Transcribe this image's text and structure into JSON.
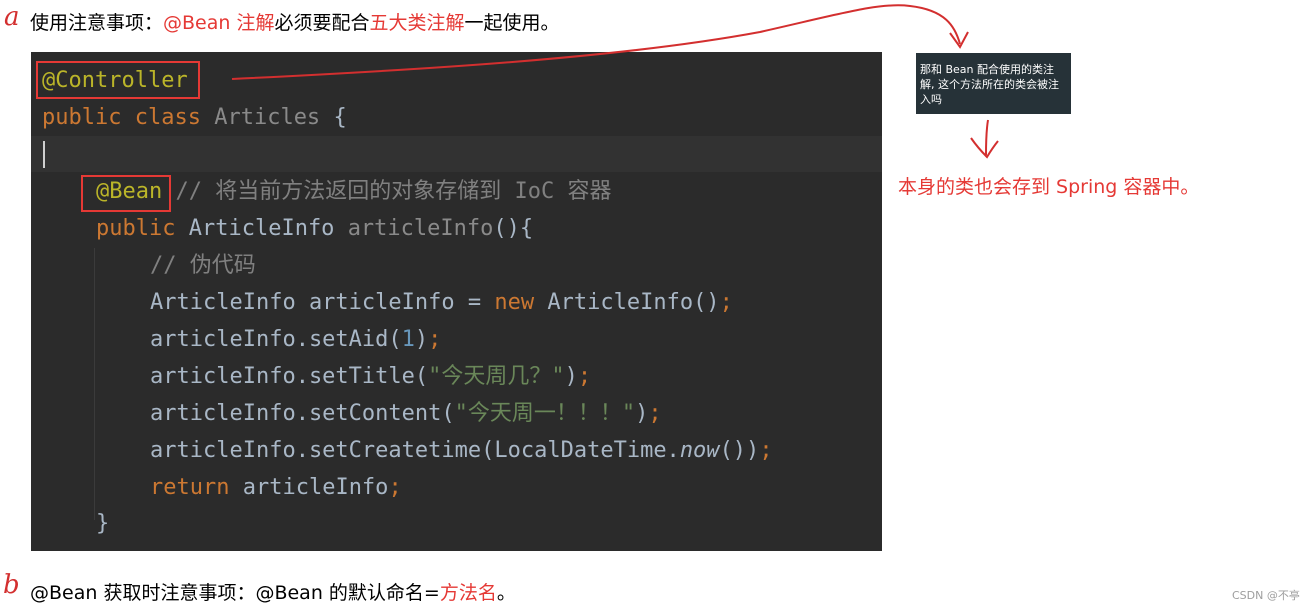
{
  "notes": {
    "a_marker": "a",
    "a_part1": "使用注意事项：",
    "a_part2": "@Bean 注解",
    "a_part3": "必须要配合",
    "a_part4": "五大类注解",
    "a_part5": "一起使用。",
    "b_marker": "b",
    "b_part1": "@Bean 获取时注意事项：@Bean 的默认命名=",
    "b_part2": "方法名",
    "b_part3": "。"
  },
  "code": {
    "l1_annotation": "@Controller",
    "l2_kw1": "public",
    "l2_kw2": "class",
    "l2_name": "Articles",
    "l2_brace": "{",
    "l4_annotation": "@Bean",
    "l4_comment": "// 将当前方法返回的对象存储到 IoC 容器",
    "l5_kw": "public",
    "l5_type": "ArticleInfo",
    "l5_method": "articleInfo",
    "l5_rest": "(){",
    "l6_comment": "// 伪代码",
    "l7_a": "ArticleInfo articleInfo = ",
    "l7_kw": "new",
    "l7_b": " ArticleInfo()",
    "l7_semi": ";",
    "l8_a": "articleInfo.setAid(",
    "l8_num": "1",
    "l8_b": ")",
    "l8_semi": ";",
    "l9_a": "articleInfo.setTitle(",
    "l9_str": "\"今天周几？\"",
    "l9_b": ")",
    "l9_semi": ";",
    "l10_a": "articleInfo.setContent(",
    "l10_str": "\"今天周一！！！\"",
    "l10_b": ")",
    "l10_semi": ";",
    "l11_a": "articleInfo.setCreatetime(LocalDateTime.",
    "l11_it": "now",
    "l11_b": "())",
    "l11_semi": ";",
    "l12_kw": "return",
    "l12_rest": " articleInfo",
    "l12_semi": ";",
    "l13_brace": "}"
  },
  "tooltip": {
    "text": "那和 Bean 配合使用的类注解, 这个方法所在的类会被注入吗"
  },
  "side_note": "本身的类也会存到 Spring 容器中。",
  "watermark": "CSDN @不亭",
  "colors": {
    "annotation_red": "#e53935",
    "editor_bg": "#2b2b2b",
    "keyword": "#cc7832",
    "annotation": "#bbb529",
    "string": "#6a8759",
    "number": "#6897bb",
    "comment": "#808080"
  }
}
